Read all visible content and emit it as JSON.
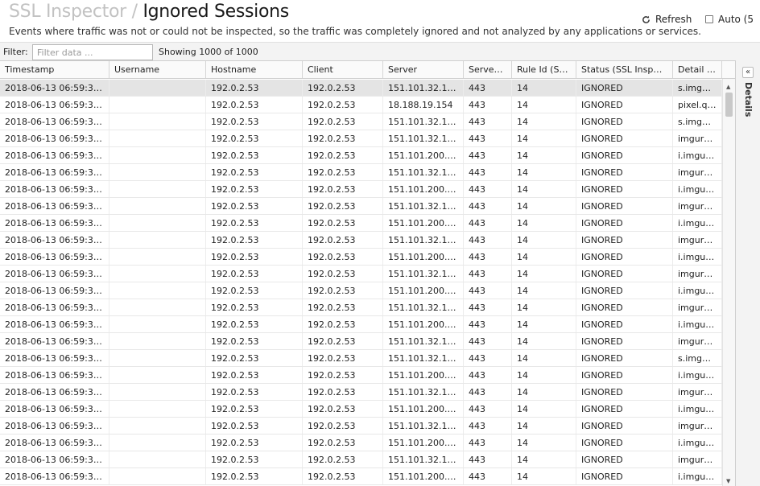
{
  "header": {
    "crumb": "SSL Inspector",
    "separator": "/",
    "title": "Ignored Sessions",
    "subtitle": "Events where traffic was not or could not be inspected, so the traffic was completely ignored and not analyzed by any applications or services.",
    "refresh_label": "Refresh",
    "auto_label": "Auto (5"
  },
  "filter": {
    "label": "Filter:",
    "placeholder": "Filter data ...",
    "showing": "Showing 1000 of 1000"
  },
  "side": {
    "collapse_glyph": "«",
    "details_label": "Details"
  },
  "columns": [
    "Timestamp",
    "Username",
    "Hostname",
    "Client",
    "Server",
    "Serve…",
    "Rule Id (S…",
    "Status (SSL Insp…",
    "Detail …"
  ],
  "rows": [
    [
      "2018-06-13 06:59:3…",
      "",
      "192.0.2.53",
      "192.0.2.53",
      "151.101.32.1…",
      "443",
      "14",
      "IGNORED",
      "s.img…"
    ],
    [
      "2018-06-13 06:59:3…",
      "",
      "192.0.2.53",
      "192.0.2.53",
      "18.188.19.154",
      "443",
      "14",
      "IGNORED",
      "pixel.q…"
    ],
    [
      "2018-06-13 06:59:3…",
      "",
      "192.0.2.53",
      "192.0.2.53",
      "151.101.32.1…",
      "443",
      "14",
      "IGNORED",
      "s.img…"
    ],
    [
      "2018-06-13 06:59:3…",
      "",
      "192.0.2.53",
      "192.0.2.53",
      "151.101.32.1…",
      "443",
      "14",
      "IGNORED",
      "imgur…"
    ],
    [
      "2018-06-13 06:59:3…",
      "",
      "192.0.2.53",
      "192.0.2.53",
      "151.101.200.…",
      "443",
      "14",
      "IGNORED",
      "i.imgu…"
    ],
    [
      "2018-06-13 06:59:3…",
      "",
      "192.0.2.53",
      "192.0.2.53",
      "151.101.32.1…",
      "443",
      "14",
      "IGNORED",
      "imgur…"
    ],
    [
      "2018-06-13 06:59:3…",
      "",
      "192.0.2.53",
      "192.0.2.53",
      "151.101.200.…",
      "443",
      "14",
      "IGNORED",
      "i.imgu…"
    ],
    [
      "2018-06-13 06:59:3…",
      "",
      "192.0.2.53",
      "192.0.2.53",
      "151.101.32.1…",
      "443",
      "14",
      "IGNORED",
      "imgur…"
    ],
    [
      "2018-06-13 06:59:3…",
      "",
      "192.0.2.53",
      "192.0.2.53",
      "151.101.200.…",
      "443",
      "14",
      "IGNORED",
      "i.imgu…"
    ],
    [
      "2018-06-13 06:59:3…",
      "",
      "192.0.2.53",
      "192.0.2.53",
      "151.101.32.1…",
      "443",
      "14",
      "IGNORED",
      "imgur…"
    ],
    [
      "2018-06-13 06:59:3…",
      "",
      "192.0.2.53",
      "192.0.2.53",
      "151.101.200.…",
      "443",
      "14",
      "IGNORED",
      "i.imgu…"
    ],
    [
      "2018-06-13 06:59:3…",
      "",
      "192.0.2.53",
      "192.0.2.53",
      "151.101.32.1…",
      "443",
      "14",
      "IGNORED",
      "imgur…"
    ],
    [
      "2018-06-13 06:59:3…",
      "",
      "192.0.2.53",
      "192.0.2.53",
      "151.101.200.…",
      "443",
      "14",
      "IGNORED",
      "i.imgu…"
    ],
    [
      "2018-06-13 06:59:3…",
      "",
      "192.0.2.53",
      "192.0.2.53",
      "151.101.32.1…",
      "443",
      "14",
      "IGNORED",
      "imgur…"
    ],
    [
      "2018-06-13 06:59:3…",
      "",
      "192.0.2.53",
      "192.0.2.53",
      "151.101.200.…",
      "443",
      "14",
      "IGNORED",
      "i.imgu…"
    ],
    [
      "2018-06-13 06:59:3…",
      "",
      "192.0.2.53",
      "192.0.2.53",
      "151.101.32.1…",
      "443",
      "14",
      "IGNORED",
      "imgur…"
    ],
    [
      "2018-06-13 06:59:3…",
      "",
      "192.0.2.53",
      "192.0.2.53",
      "151.101.32.1…",
      "443",
      "14",
      "IGNORED",
      "s.img…"
    ],
    [
      "2018-06-13 06:59:3…",
      "",
      "192.0.2.53",
      "192.0.2.53",
      "151.101.200.…",
      "443",
      "14",
      "IGNORED",
      "i.imgu…"
    ],
    [
      "2018-06-13 06:59:3…",
      "",
      "192.0.2.53",
      "192.0.2.53",
      "151.101.32.1…",
      "443",
      "14",
      "IGNORED",
      "imgur…"
    ],
    [
      "2018-06-13 06:59:3…",
      "",
      "192.0.2.53",
      "192.0.2.53",
      "151.101.200.…",
      "443",
      "14",
      "IGNORED",
      "i.imgu…"
    ],
    [
      "2018-06-13 06:59:3…",
      "",
      "192.0.2.53",
      "192.0.2.53",
      "151.101.32.1…",
      "443",
      "14",
      "IGNORED",
      "imgur…"
    ],
    [
      "2018-06-13 06:59:3…",
      "",
      "192.0.2.53",
      "192.0.2.53",
      "151.101.200.…",
      "443",
      "14",
      "IGNORED",
      "i.imgu…"
    ],
    [
      "2018-06-13 06:59:3…",
      "",
      "192.0.2.53",
      "192.0.2.53",
      "151.101.32.1…",
      "443",
      "14",
      "IGNORED",
      "imgur…"
    ],
    [
      "2018-06-13 06:59:3…",
      "",
      "192.0.2.53",
      "192.0.2.53",
      "151.101.200.…",
      "443",
      "14",
      "IGNORED",
      "i.imgu…"
    ]
  ]
}
